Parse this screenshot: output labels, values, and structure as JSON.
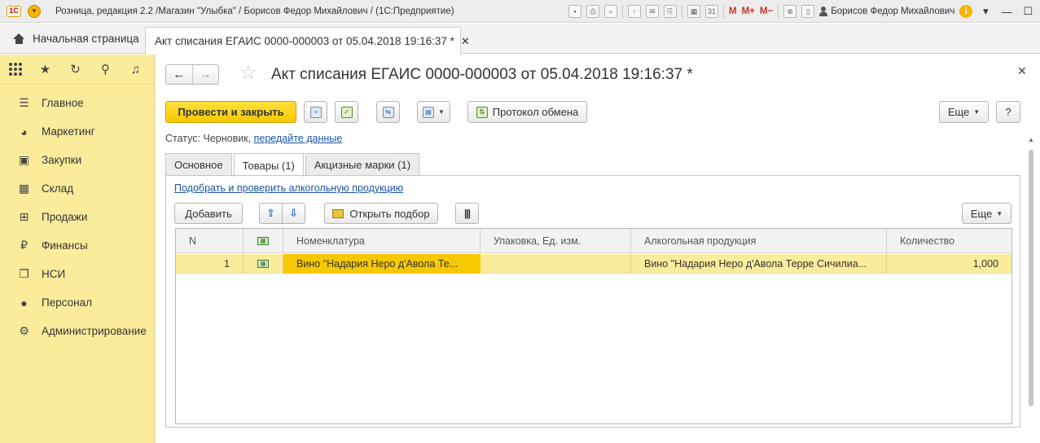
{
  "window": {
    "title": "Розница, редакция 2.2 /Магазин \"Улыбка\" / Борисов Федор Михайлович / (1С:Предприятие)",
    "logo": "1С",
    "toolbar_labels": [
      "M",
      "M+",
      "M−"
    ],
    "user": "Борисов Федор Михайлович"
  },
  "tabs": {
    "home": "Начальная страница",
    "document": "Акт списания ЕГАИС 0000-000003 от 05.04.2018 19:16:37 *"
  },
  "sidebar": {
    "items": [
      {
        "label": "Главное",
        "icon": "menu-lines-icon"
      },
      {
        "label": "Маркетинг",
        "icon": "pie-chart-icon"
      },
      {
        "label": "Закупки",
        "icon": "cart-icon"
      },
      {
        "label": "Склад",
        "icon": "warehouse-icon"
      },
      {
        "label": "Продажи",
        "icon": "basket-icon"
      },
      {
        "label": "Финансы",
        "icon": "ruble-icon"
      },
      {
        "label": "НСИ",
        "icon": "layers-icon"
      },
      {
        "label": "Персонал",
        "icon": "person-icon"
      },
      {
        "label": "Администрирование",
        "icon": "gear-icon"
      }
    ]
  },
  "document": {
    "title": "Акт списания ЕГАИС 0000-000003 от 05.04.2018 19:16:37 *",
    "toolbar": {
      "post_close": "Провести и закрыть",
      "exchange_log": "Протокол обмена",
      "more": "Еще",
      "help": "?"
    },
    "status_label": "Статус:",
    "status_value": "Черновик,",
    "status_link": "передайте данные",
    "tabs": [
      "Основное",
      "Товары (1)",
      "Акцизные марки (1)"
    ],
    "active_tab": 1,
    "products": {
      "pick_link": "Подобрать и проверить алкогольную продукцию",
      "add": "Добавить",
      "open_selection": "Открыть подбор",
      "more": "Еще",
      "columns": [
        "N",
        "",
        "Номенклатура",
        "Упаковка, Ед. изм.",
        "Алкогольная продукция",
        "Количество"
      ],
      "rows": [
        {
          "n": "1",
          "nomenclature": "Вино \"Надария Неро д'Авола Те...",
          "package": "",
          "alcohol": "Вино \"Надария Неро д'Авола Терре Сичилиа...",
          "quantity": "1,000"
        }
      ]
    }
  }
}
